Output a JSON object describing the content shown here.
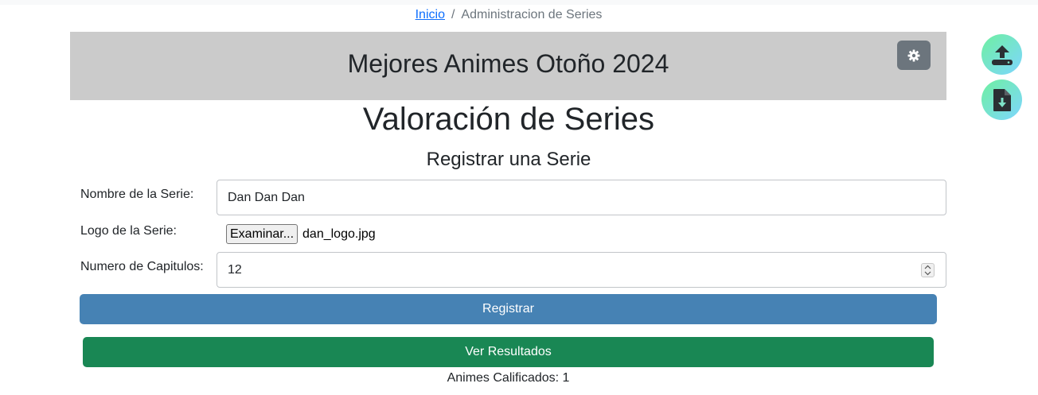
{
  "breadcrumb": {
    "home": "Inicio",
    "separator": "/",
    "current": "Administracion de Series"
  },
  "banner": {
    "title": "Mejores Animes Otoño 2024",
    "settings_icon": "gear-icon"
  },
  "floating_actions": {
    "upload_icon": "upload-icon",
    "download_icon": "file-download-icon"
  },
  "page": {
    "title": "Valoración de Series",
    "subtitle": "Registrar una Serie"
  },
  "form": {
    "name_label": "Nombre de la Serie:",
    "name_value": "Dan Dan Dan",
    "logo_label": "Logo de la Serie:",
    "file_button": "Examinar...",
    "file_name": "dan_logo.jpg",
    "chapters_label": "Numero de Capitulos:",
    "chapters_value": "12"
  },
  "buttons": {
    "register": "Registrar",
    "results": "Ver Resultados"
  },
  "status": {
    "rated_count": "Animes Calificados: 1"
  },
  "colors": {
    "register": "#4682b4",
    "results": "#198754",
    "banner": "#cbcbcb",
    "settings": "#6c757d"
  }
}
